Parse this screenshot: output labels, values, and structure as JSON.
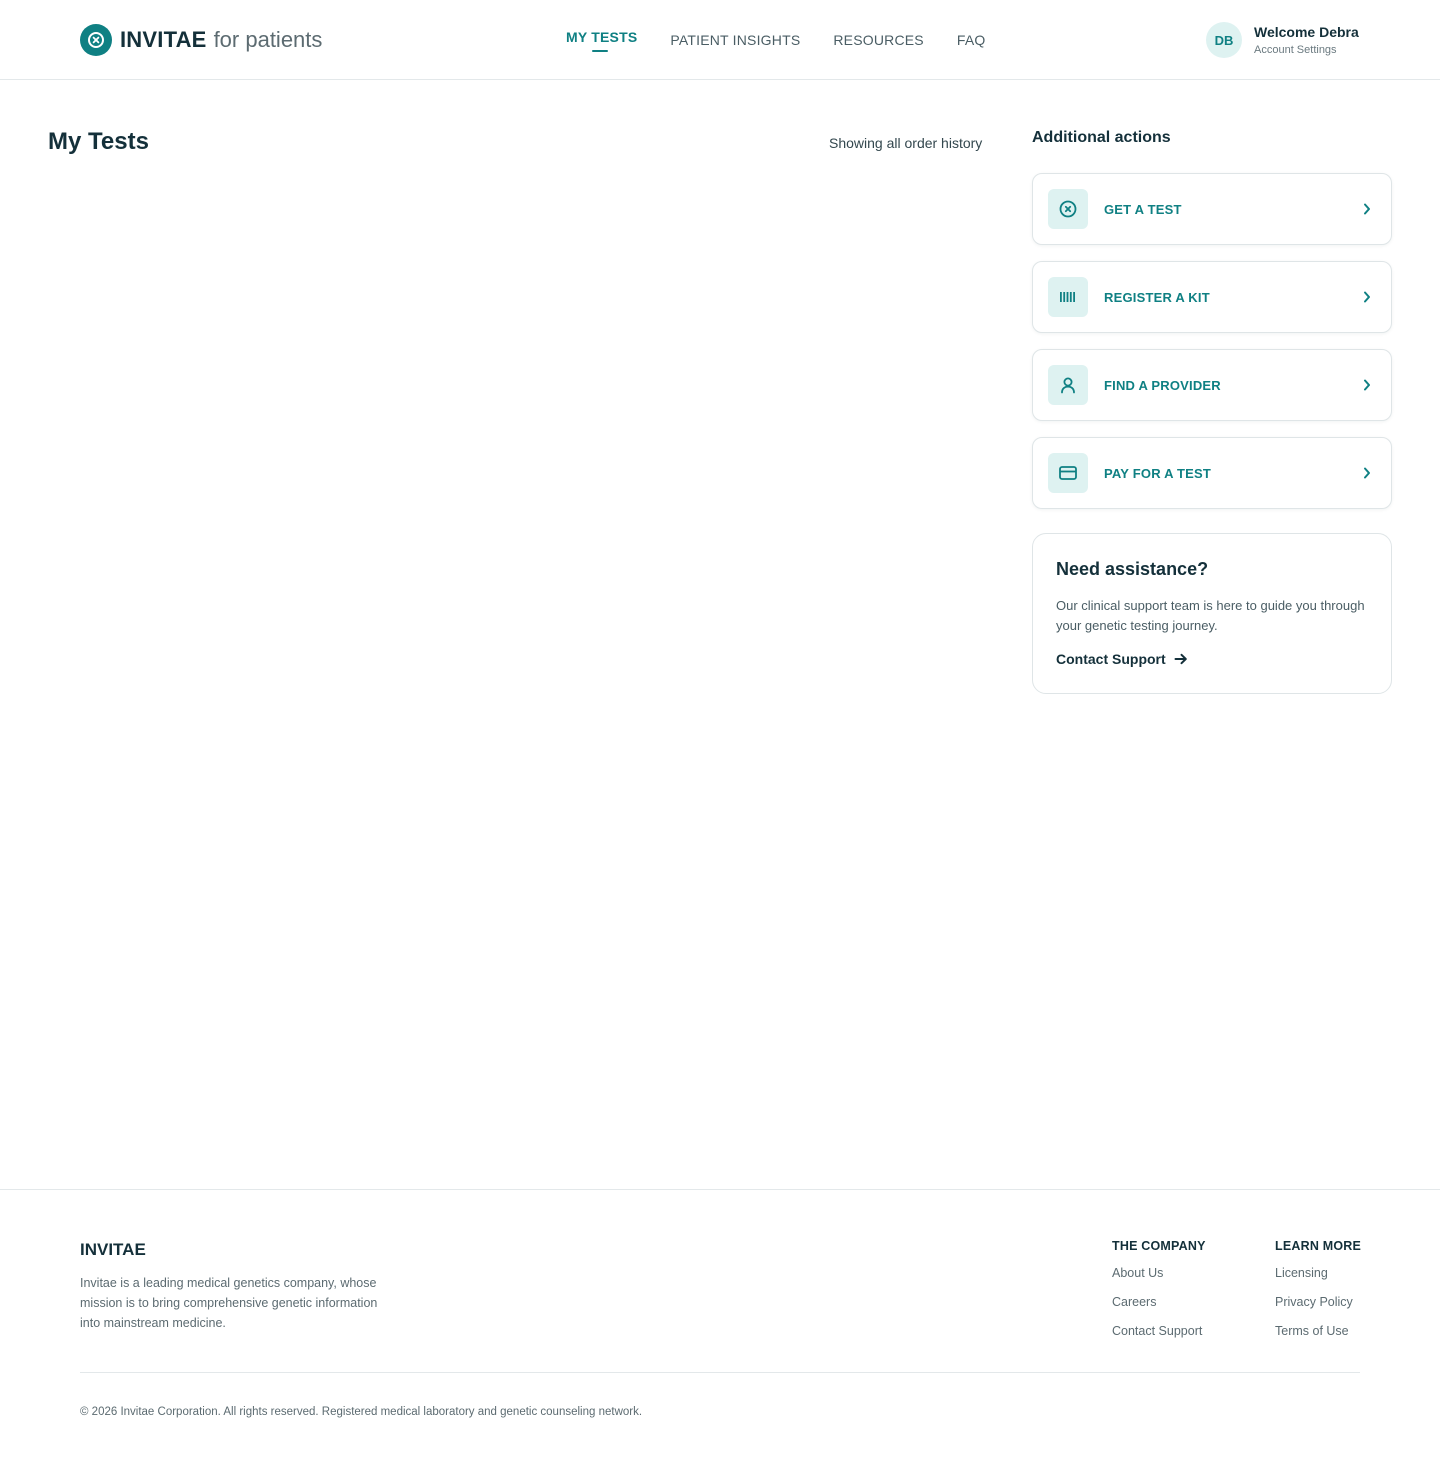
{
  "header": {
    "brand": "INVITAE",
    "brand_suffix": "for patients",
    "nav": [
      {
        "label": "MY TESTS",
        "active": true
      },
      {
        "label": "PATIENT INSIGHTS",
        "active": false
      },
      {
        "label": "RESOURCES",
        "active": false
      },
      {
        "label": "FAQ",
        "active": false
      }
    ],
    "user": {
      "initials": "DB",
      "welcome": "Welcome Debra",
      "account_link": "Account Settings"
    }
  },
  "main": {
    "title": "My Tests",
    "history_label": "Showing all order history"
  },
  "aside": {
    "title": "Additional actions",
    "actions": [
      {
        "label": "GET A TEST",
        "icon": "invitae-mark-icon"
      },
      {
        "label": "REGISTER A KIT",
        "icon": "barcode-icon"
      },
      {
        "label": "FIND A PROVIDER",
        "icon": "person-icon"
      },
      {
        "label": "PAY FOR A TEST",
        "icon": "credit-card-icon"
      }
    ],
    "assistance": {
      "title": "Need assistance?",
      "text": "Our clinical support team is here to guide you through your genetic testing journey.",
      "link": "Contact Support"
    }
  },
  "footer": {
    "brand": "INVITAE",
    "description": "Invitae is a leading medical genetics company, whose mission is to bring comprehensive genetic information into mainstream medicine.",
    "columns": [
      {
        "title": "THE COMPANY",
        "links": [
          "About Us",
          "Careers",
          "Contact Support"
        ]
      },
      {
        "title": "LEARN MORE",
        "links": [
          "Licensing",
          "Privacy Policy",
          "Terms of Use"
        ]
      }
    ],
    "copyright": "© 2026 Invitae Corporation. All rights reserved. Registered medical laboratory and genetic counseling network."
  },
  "colors": {
    "accent": "#0f8083",
    "accent_light": "#def2f1",
    "text_dark": "#14303a",
    "text_muted": "#5c6b71",
    "border": "#e3e8ea"
  }
}
